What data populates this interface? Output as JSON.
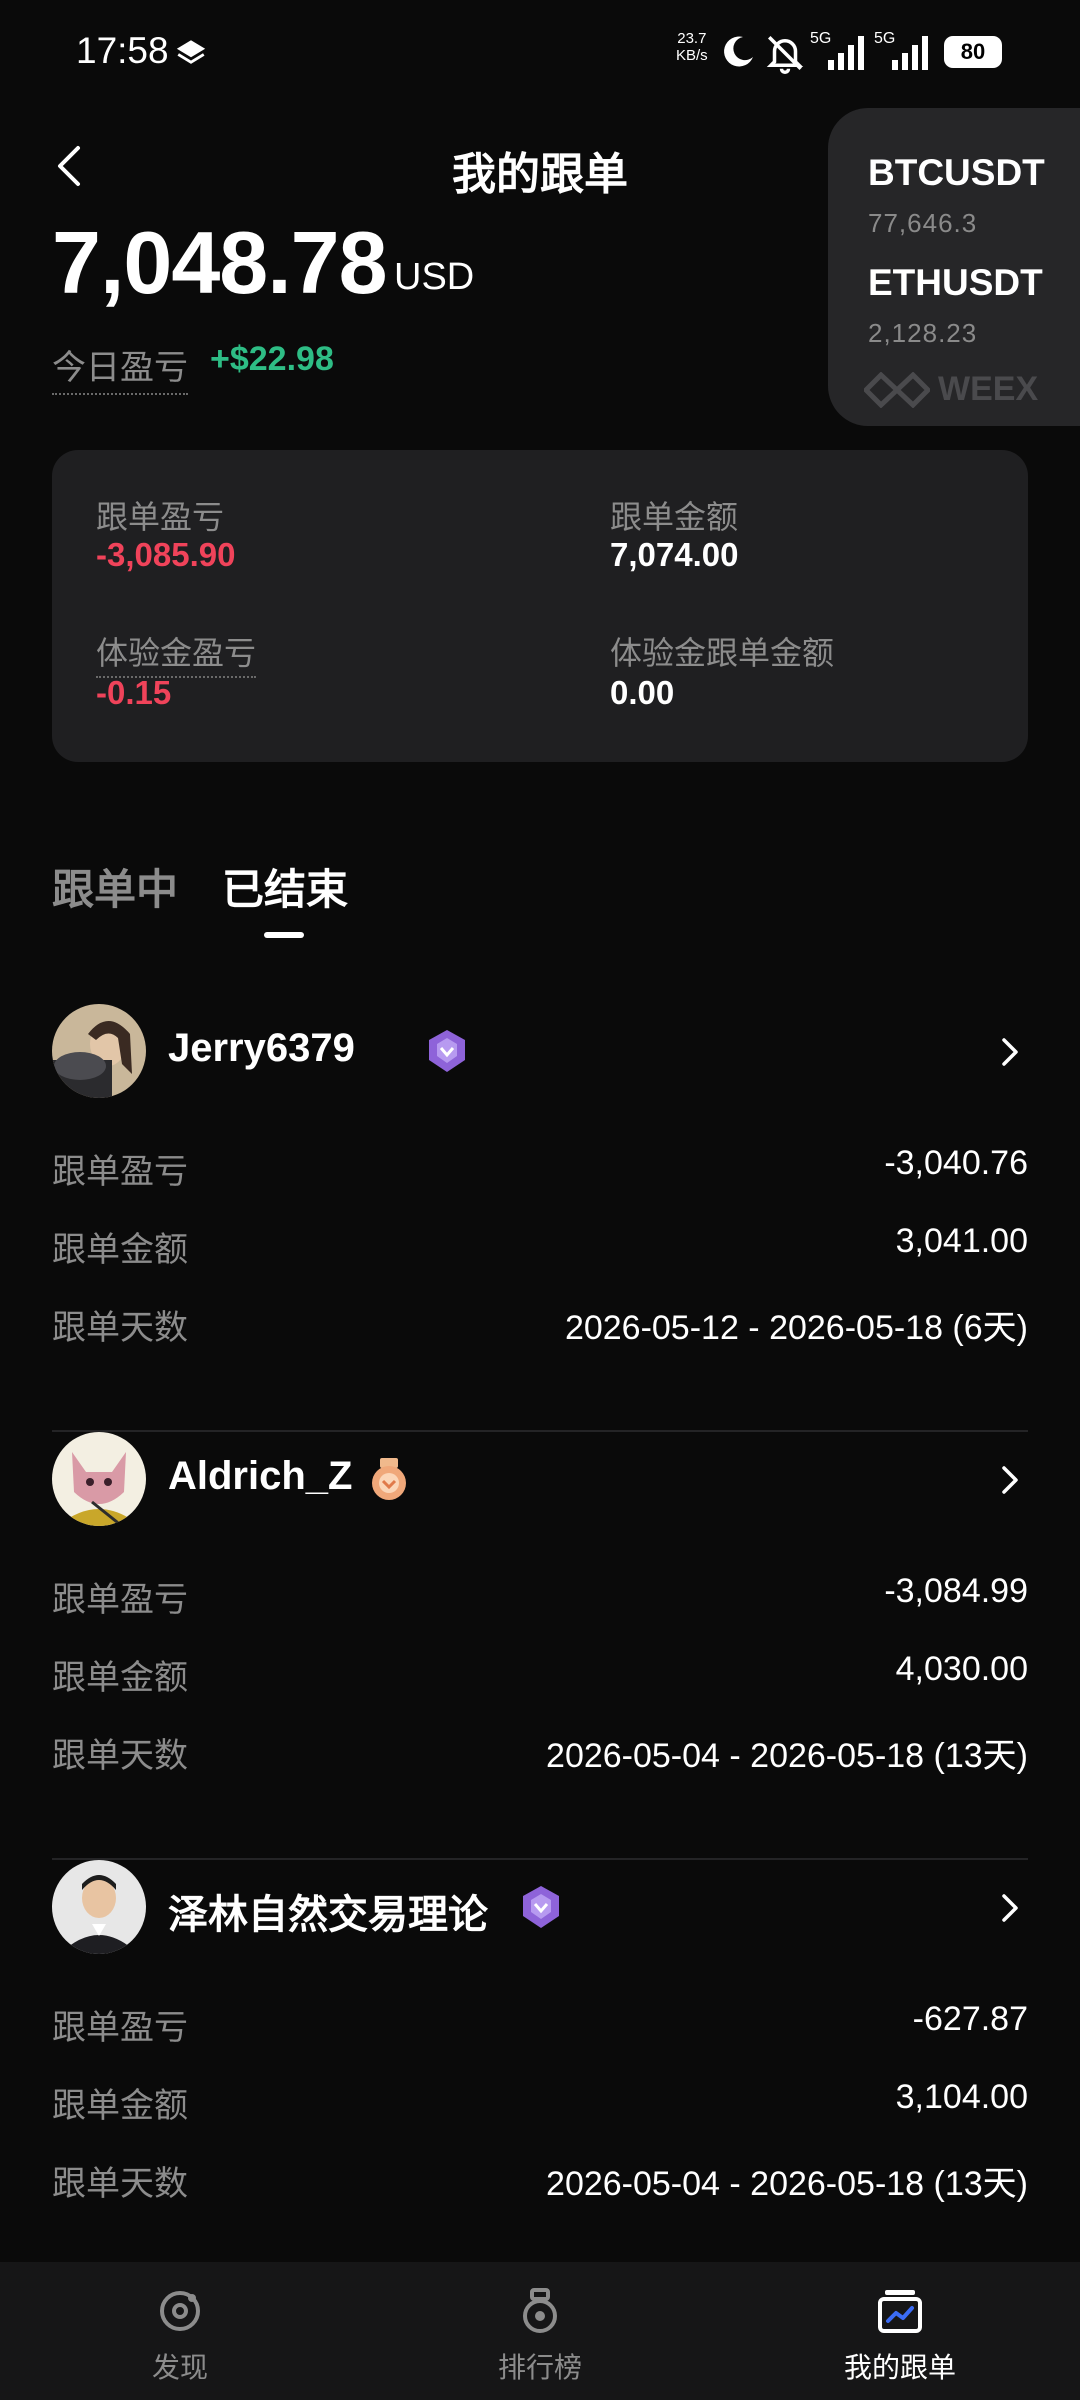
{
  "status_bar": {
    "time": "17:58",
    "net_speed_value": "23.7",
    "net_speed_unit": "KB/s",
    "sim1": "5G",
    "sim2": "5G",
    "battery": "80"
  },
  "header": {
    "title": "我的跟单",
    "total_value": "7,048.78",
    "total_unit": "USD",
    "today_pnl_label": "今日盈亏",
    "today_pnl_value": "+$22.98"
  },
  "ticker": {
    "items": [
      {
        "symbol": "BTCUSDT",
        "price": "77,646.3"
      },
      {
        "symbol": "ETHUSDT",
        "price": "2,128.23"
      }
    ],
    "brand": "WEEX"
  },
  "summary": {
    "copy_pnl_label": "跟单盈亏",
    "copy_pnl_value": "-3,085.90",
    "copy_amount_label": "跟单金额",
    "copy_amount_value": "7,074.00",
    "trial_pnl_label": "体验金盈亏",
    "trial_pnl_value": "-0.15",
    "trial_amount_label": "体验金跟单金额",
    "trial_amount_value": "0.00"
  },
  "tabs": {
    "active_tab": "已结束",
    "inactive_tab": "跟单中"
  },
  "traders": [
    {
      "name": "Jerry6379",
      "badge": "purple-medal-icon",
      "pnl_label": "跟单盈亏",
      "pnl_value": "-3,040.76",
      "amount_label": "跟单金额",
      "amount_value": "3,041.00",
      "days_label": "跟单天数",
      "days_value": "2026-05-12 - 2026-05-18 (6天)"
    },
    {
      "name": "Aldrich_Z",
      "badge": "bronze-medal-icon",
      "pnl_label": "跟单盈亏",
      "pnl_value": "-3,084.99",
      "amount_label": "跟单金额",
      "amount_value": "4,030.00",
      "days_label": "跟单天数",
      "days_value": "2026-05-04 - 2026-05-18 (13天)"
    },
    {
      "name": "泽林自然交易理论",
      "badge": "purple-medal-icon",
      "pnl_label": "跟单盈亏",
      "pnl_value": "-627.87",
      "amount_label": "跟单金额",
      "amount_value": "3,104.00",
      "days_label": "跟单天数",
      "days_value": "2026-05-04 - 2026-05-18 (13天)"
    }
  ],
  "bottom_nav": {
    "discover": "发现",
    "leaderboard": "排行榜",
    "my_copy": "我的跟单"
  },
  "colors": {
    "background": "#0a0a0a",
    "card": "#1f1f21",
    "negative": "#f0435a",
    "positive": "#2ebd85",
    "muted": "#8c8c8c"
  }
}
